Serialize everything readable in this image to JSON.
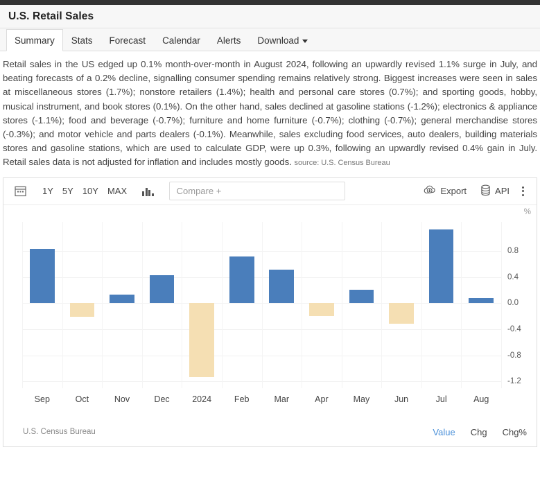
{
  "header": {
    "title": "U.S. Retail Sales"
  },
  "tabs": [
    {
      "label": "Summary",
      "active": true
    },
    {
      "label": "Stats",
      "active": false
    },
    {
      "label": "Forecast",
      "active": false
    },
    {
      "label": "Calendar",
      "active": false
    },
    {
      "label": "Alerts",
      "active": false
    },
    {
      "label": "Download",
      "active": false,
      "caret": true
    }
  ],
  "summary": {
    "body": "Retail sales in the US edged up 0.1% month-over-month in August 2024, following an upwardly revised 1.1% surge in July, and beating forecasts of a 0.2% decline, signalling consumer spending remains relatively strong. Biggest increases were seen in sales at miscellaneous stores (1.7%); nonstore retailers (1.4%); health and personal care stores (0.7%); and sporting goods, hobby, musical instrument, and book stores (0.1%). On the other hand, sales declined at gasoline stations (-1.2%); electronics & appliance stores (-1.1%); food and beverage (-0.7%); furniture and home furniture (-0.7%); clothing (-0.7%); general merchandise stores (-0.3%); and motor vehicle and parts dealers (-0.1%). Meanwhile, sales excluding food services, auto dealers, building materials stores and gasoline stations, which are used to calculate GDP, were up 0.3%, following an upwardly revised 0.4% gain in July. Retail sales data is not adjusted for inflation and includes mostly goods.",
    "source": "source: U.S. Census Bureau"
  },
  "toolbar": {
    "calendar_icon": "calendar-icon",
    "ranges": [
      "1Y",
      "5Y",
      "10Y",
      "MAX"
    ],
    "chart_type_icon": "bar-chart-icon",
    "compare_placeholder": "Compare +",
    "export_label": "Export",
    "api_label": "API",
    "menu_icon": "kebab-menu-icon"
  },
  "chart_footer": {
    "source": "U.S. Census Bureau",
    "toggles": [
      {
        "label": "Value",
        "active": true
      },
      {
        "label": "Chg",
        "active": false
      },
      {
        "label": "Chg%",
        "active": false
      }
    ]
  },
  "chart_data": {
    "type": "bar",
    "title": "U.S. Retail Sales",
    "unit": "%",
    "xlabel": "",
    "ylabel": "%",
    "ylim": [
      -1.3,
      1.25
    ],
    "yticks": [
      0.8,
      0.4,
      0.0,
      -0.4,
      -0.8,
      -1.2
    ],
    "ytick_labels": [
      "0.8",
      "0.4",
      "0.0",
      "-0.4",
      "-0.8",
      "-1.2"
    ],
    "grid": true,
    "legend": false,
    "categories": [
      "Sep",
      "Oct",
      "Nov",
      "Dec",
      "2024",
      "Feb",
      "Mar",
      "Apr",
      "May",
      "Jun",
      "Jul",
      "Aug"
    ],
    "values": [
      0.83,
      -0.21,
      0.13,
      0.43,
      -1.13,
      0.71,
      0.51,
      -0.2,
      0.2,
      -0.32,
      1.13,
      0.08
    ],
    "colors": {
      "positive": "#4a7ebb",
      "negative": "#f5dfb3",
      "grid": "#f1f1f1",
      "accent": "#4a90d9"
    }
  }
}
